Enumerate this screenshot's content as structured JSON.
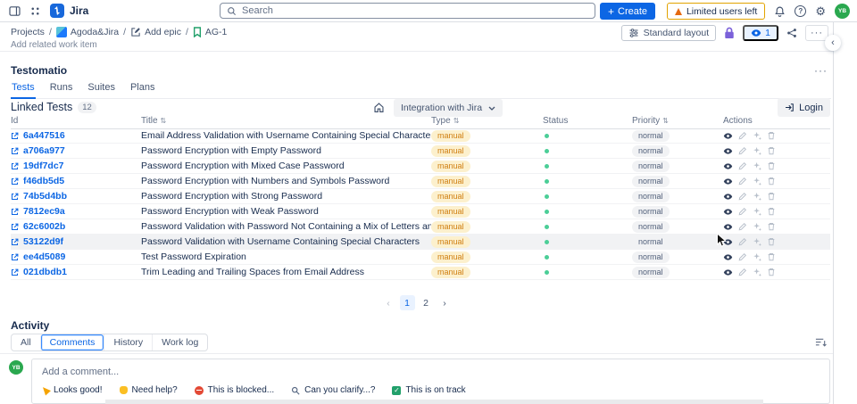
{
  "topnav": {
    "logo_text": "Jira",
    "search_placeholder": "Search",
    "create_label": "Create",
    "warning_label": "Limited users left",
    "avatar_initials": "YB"
  },
  "breadcrumb": {
    "separator": "/",
    "projects": "Projects",
    "project_name": "Agoda&Jira",
    "add_epic": "Add epic",
    "issue_key": "AG-1"
  },
  "page_toolbar": {
    "layout_label": "Standard layout",
    "watchers_count": "1"
  },
  "clipped_section_label": "Add related work item",
  "testomatio": {
    "title": "Testomatio",
    "tabs": [
      "Tests",
      "Runs",
      "Suites",
      "Plans"
    ],
    "active_tab": "Tests",
    "section_title": "Linked Tests",
    "count_badge": "12",
    "project_selector": "Integration with Jira",
    "login_label": "Login"
  },
  "table": {
    "headers": [
      "Id",
      "Title",
      "Type",
      "Status",
      "Priority",
      "Actions"
    ],
    "highlighted_row_index": 7,
    "rows": [
      {
        "id": "6a447516",
        "title": "Email Address Validation with Username Containing Special Characters",
        "type": "manual",
        "status": "green",
        "priority": "normal"
      },
      {
        "id": "a706a977",
        "title": "Password Encryption with Empty Password",
        "type": "manual",
        "status": "green",
        "priority": "normal"
      },
      {
        "id": "19df7dc7",
        "title": "Password Encryption with Mixed Case Password",
        "type": "manual",
        "status": "green",
        "priority": "normal"
      },
      {
        "id": "f46db5d5",
        "title": "Password Encryption with Numbers and Symbols Password",
        "type": "manual",
        "status": "green",
        "priority": "normal"
      },
      {
        "id": "74b5d4bb",
        "title": "Password Encryption with Strong Password",
        "type": "manual",
        "status": "green",
        "priority": "normal"
      },
      {
        "id": "7812ec9a",
        "title": "Password Encryption with Weak Password",
        "type": "manual",
        "status": "green",
        "priority": "normal"
      },
      {
        "id": "62c6002b",
        "title": "Password Validation with Password Not Containing a Mix of Letters and Numbers",
        "type": "manual",
        "status": "green",
        "priority": "normal"
      },
      {
        "id": "53122d9f",
        "title": "Password Validation with Username Containing Special Characters",
        "type": "manual",
        "status": "green",
        "priority": "normal"
      },
      {
        "id": "ee4d5089",
        "title": "Test Password Expiration",
        "type": "manual",
        "status": "green",
        "priority": "normal"
      },
      {
        "id": "021dbdb1",
        "title": "Trim Leading and Trailing Spaces from Email Address",
        "type": "manual",
        "status": "green",
        "priority": "normal"
      }
    ]
  },
  "pagination": {
    "pages": [
      "1",
      "2"
    ],
    "active_page": "1"
  },
  "activity": {
    "title": "Activity",
    "tabs": [
      "All",
      "Comments",
      "History",
      "Work log"
    ],
    "active_tab": "Comments"
  },
  "comment": {
    "avatar_initials": "YB",
    "placeholder": "Add a comment...",
    "quick_replies": [
      {
        "icon": "party-popper-icon",
        "label": "Looks good!"
      },
      {
        "icon": "waving-hand-icon",
        "label": "Need help?"
      },
      {
        "icon": "no-entry-icon",
        "label": "This is blocked..."
      },
      {
        "icon": "magnifier-icon",
        "label": "Can you clarify...?"
      },
      {
        "icon": "check-mark-icon",
        "label": "This is on track"
      }
    ]
  },
  "icons": {
    "sort": "⇅",
    "more": "···",
    "question": "?",
    "gear": "⚙",
    "plus": "+",
    "prev": "‹",
    "next": "›",
    "panel_collapse": "‹",
    "check": "✓"
  },
  "colors": {
    "accent": "#0c66e4",
    "link": "#0c66e4",
    "warning_border": "#e2a300",
    "warning_icon": "#e56910",
    "lock": "#7b61d9",
    "status_dot": "#4bce97",
    "avatar_bg": "#2aa84f",
    "type_badge_bg": "#fcf0cd",
    "type_badge_text": "#cf7e10",
    "highlight_row": "#f1f2f4"
  }
}
